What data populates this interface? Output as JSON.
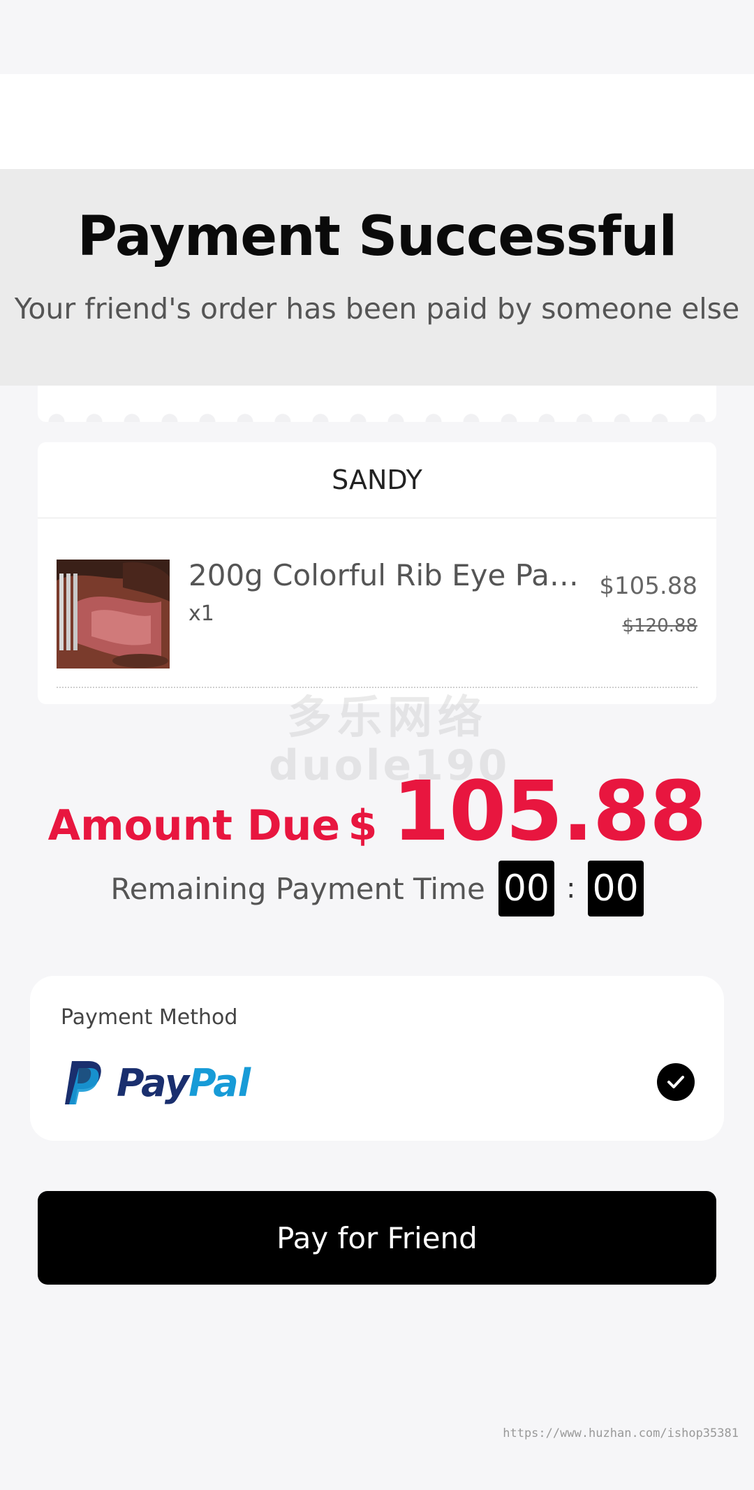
{
  "header": {
    "title": "Payment Successful",
    "subtitle": "Your friend's order has been paid by someone else"
  },
  "order": {
    "shop_name": "SANDY",
    "item": {
      "name": "200g Colorful Rib Eye Pac…",
      "quantity": "x1",
      "price": "$105.88",
      "original_price": "$120.88"
    }
  },
  "watermark": {
    "line1": "多乐网络",
    "line2": "duole190"
  },
  "amount": {
    "label": "Amount Due",
    "currency": "$",
    "value": "105.88",
    "color": "#e8163f"
  },
  "timer": {
    "label": "Remaining Payment Time",
    "minutes": "00",
    "separator": ":",
    "seconds": "00"
  },
  "payment": {
    "title": "Payment Method",
    "method": {
      "pay": "Pay",
      "pal": "Pal",
      "selected": true,
      "icon": "paypal-icon"
    }
  },
  "action": {
    "pay_label": "Pay for Friend"
  },
  "footer": {
    "url": "https://www.huzhan.com/ishop35381"
  }
}
